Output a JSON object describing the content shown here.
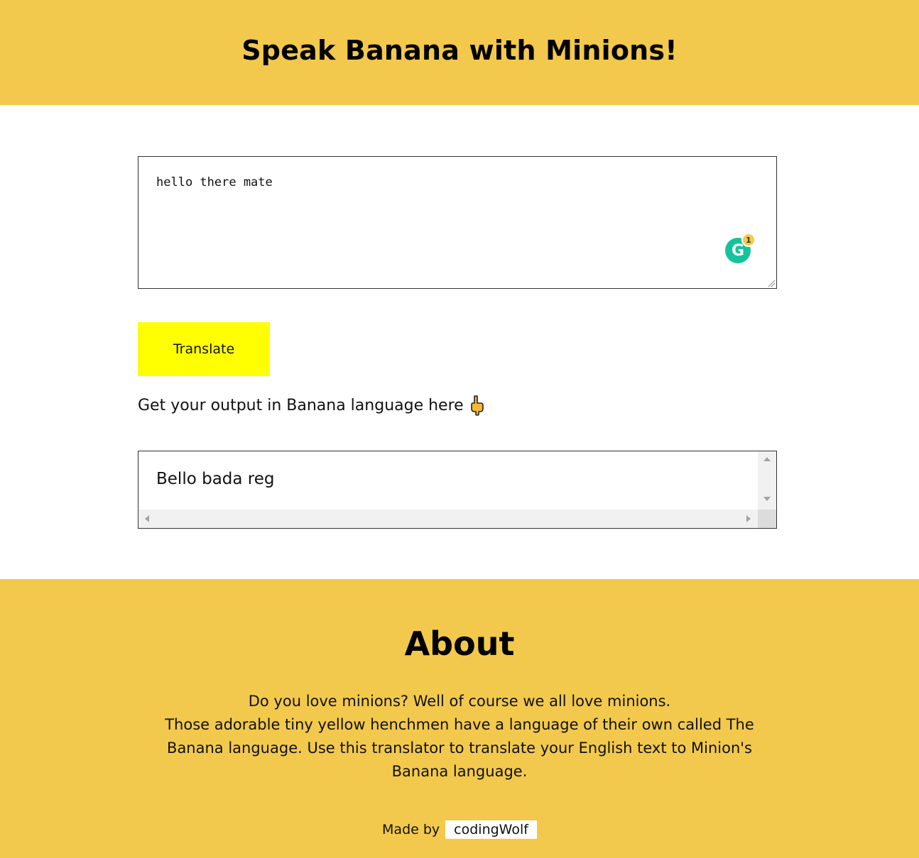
{
  "header": {
    "title": "Speak Banana with Minions!"
  },
  "input": {
    "value": "hello there mate",
    "grammarly_badge_count": "1"
  },
  "translate_button": {
    "label": "Translate"
  },
  "output": {
    "label": "Get your output in Banana language here",
    "value": "Bello bada reg"
  },
  "about": {
    "heading": "About",
    "line1": "Do you love minions? Well of course we all love minions.",
    "line2": "Those adorable tiny yellow henchmen have a language of their own called The Banana language. Use this translator to translate your English text to Minion's Banana language."
  },
  "footer": {
    "made_by_label": "Made by",
    "author": "codingWolf"
  },
  "colors": {
    "brand_yellow": "#f2c94c",
    "button_yellow": "#ffff00",
    "grammarly_green": "#15c39a"
  },
  "icons": {
    "grammarly": "grammarly-icon",
    "pointer": "pointing-down-hand-icon",
    "resize": "resize-grip-icon"
  }
}
